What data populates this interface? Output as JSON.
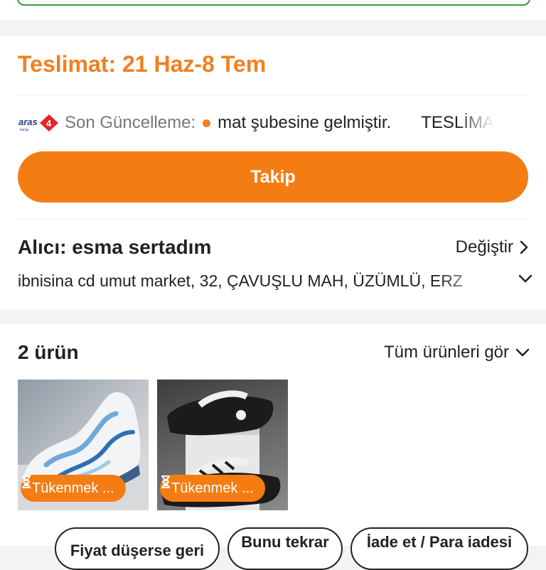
{
  "delivery": {
    "label": "Teslimat: 21 Haz-8 Tem"
  },
  "tracking": {
    "carrier_icon": "aras-kargo-logo",
    "label": "Son Güncelleme:",
    "message": "mat şubesine gelmiştir.",
    "message_next": "TESLİMA",
    "button": "Takip"
  },
  "recipient": {
    "name": "Alıcı: esma sertadım",
    "change": "Değiştir",
    "address": "ibnisina cd umut market, 32, ÇAVUŞLU MAH, ÜZÜMLÜ, ERZ"
  },
  "products": {
    "count": "2 ürün",
    "see_all": "Tüm ürünleri gör",
    "items": [
      {
        "badge": "Tükenmek ...",
        "image": "white-blue-sneaker"
      },
      {
        "badge": "Tükenmek ...",
        "image": "black-sandals"
      }
    ]
  },
  "actions": [
    "Fiyat düşerse geri",
    "Bunu tekrar",
    "İade et / Para iadesi"
  ],
  "colors": {
    "accent": "#f47d13",
    "text": "#222222",
    "muted": "#777777"
  }
}
